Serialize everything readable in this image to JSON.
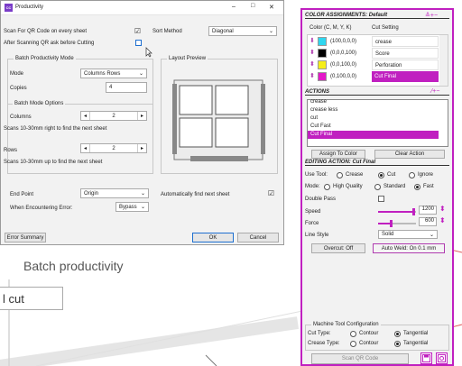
{
  "dialog": {
    "icon_text": "CC",
    "title": "Productivity",
    "win": {
      "min": "–",
      "max": "□",
      "close": "✕"
    },
    "scan_qr_label": "Scan For QR Code on every sheet",
    "scan_qr_check": "☑",
    "after_scan_label": "After Scanning QR ask before Cutting",
    "sort_method_label": "Sort Method",
    "sort_method_value": "Diagonal",
    "batch_mode_group": "Batch Productivity Mode",
    "mode_label": "Mode",
    "mode_value": "Columns Rows",
    "copies_label": "Copies",
    "copies_value": "4",
    "options_group": "Batch Mode Options",
    "columns_label": "Columns",
    "columns_value": "2",
    "columns_hint": "Scans 10-30mm right to find the next sheet",
    "rows_label": "Rows",
    "rows_value": "2",
    "rows_hint": "Scans 10-30mm up to find the next sheet",
    "layout_preview": "Layout Preview",
    "end_point_label": "End Point",
    "end_point_value": "Origin",
    "auto_find_label": "Automatically find next sheet",
    "auto_find_check": "☑",
    "error_label": "When Encountering Error:",
    "error_value": "Bypass",
    "error_summary": "Error Summary",
    "ok": "OK",
    "cancel": "Cancel"
  },
  "caption": "Batch productivity",
  "bottom_label": "l cut",
  "panel": {
    "color_header": "COLOR ASSIGNMENTS: Default",
    "color_tools": "≙+−",
    "col1": "Color (C, M, Y, K)",
    "col2": "Cut Setting",
    "colors": [
      {
        "cmyk": "(100,0,0,0)",
        "setting": "crease",
        "swatch": "#2fd6ef"
      },
      {
        "cmyk": "(0,0,0,100)",
        "setting": "Score",
        "swatch": "#000000"
      },
      {
        "cmyk": "(0,0,100,0)",
        "setting": "Perforation",
        "swatch": "#f5ee1a"
      },
      {
        "cmyk": "(0,100,0,0)",
        "setting": "Cut Final",
        "swatch": "#e418c9"
      }
    ],
    "actions_header": "ACTIONS",
    "actions_tools": "⁄+−",
    "actions": [
      "crease",
      "crease less",
      "cut",
      "Cut Fast",
      "Cut Final"
    ],
    "assign_btn": "Assign To Color",
    "clear_btn": "Clear Action",
    "editing_header": "EDITING ACTION: Cut Final",
    "use_tool_label": "Use Tool:",
    "tool_opts": [
      "Crease",
      "Cut",
      "Ignore"
    ],
    "mode_label": "Mode:",
    "mode_opts": [
      "High Quality",
      "Standard",
      "Fast"
    ],
    "double_pass": "Double Pass",
    "speed_label": "Speed",
    "speed_value": "1200",
    "speed_level": 0.95,
    "force_label": "Force",
    "force_value": "600",
    "force_level": 0.35,
    "line_style_label": "Line Style",
    "line_style_value": "Solid",
    "overcut": "Overcut: Off",
    "autoweld": "Auto Weld: On 0.1 mm",
    "machine_group": "Machine Tool Configuration",
    "cut_type_label": "Cut Type:",
    "crease_type_label": "Crease Type:",
    "type_opts": [
      "Contour",
      "Tangential"
    ],
    "scan_qr_btn": "Scan QR Code"
  },
  "colors": {
    "accent": "#c020c0",
    "selection": "#1e6fd0",
    "swatch_border": "#b03cb0"
  }
}
